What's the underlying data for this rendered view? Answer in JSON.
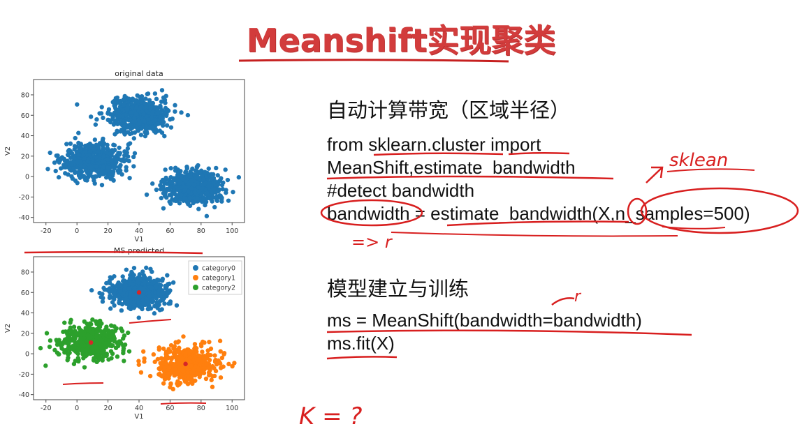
{
  "title": "Meanshift实现聚类",
  "section1": {
    "heading": "自动计算带宽（区域半径）",
    "code_lines": [
      "from sklearn.cluster import",
      "MeanShift,estimate_bandwidth",
      "#detect bandwidth",
      "bandwidth = estimate_bandwidth(X,n_samples=500)"
    ]
  },
  "section2": {
    "heading": "模型建立与训练",
    "code_lines": [
      "ms = MeanShift(bandwidth=bandwidth)",
      "ms.fit(X)"
    ]
  },
  "annotations": {
    "sklean": "sklean",
    "arrow_r": "=> r",
    "r_mark": "r",
    "k_question": "K = ?"
  },
  "chart_data": [
    {
      "type": "scatter",
      "title": "original data",
      "xlabel": "V1",
      "ylabel": "V2",
      "xlim": [
        -28,
        108
      ],
      "ylim": [
        -45,
        95
      ],
      "xticks": [
        -20,
        0,
        20,
        40,
        60,
        80,
        100
      ],
      "yticks": [
        -40,
        -20,
        0,
        20,
        40,
        60,
        80
      ],
      "series": [
        {
          "color": "#1f77b4",
          "clusters": [
            {
              "center": [
                40,
                60
              ],
              "points": 500
            },
            {
              "center": [
                10,
                15
              ],
              "points": 500
            },
            {
              "center": [
                75,
                -10
              ],
              "points": 500
            }
          ]
        }
      ]
    },
    {
      "type": "scatter",
      "title": "MS predicted",
      "xlabel": "V1",
      "ylabel": "V2",
      "xlim": [
        -28,
        108
      ],
      "ylim": [
        -45,
        95
      ],
      "xticks": [
        -20,
        0,
        20,
        40,
        60,
        80,
        100
      ],
      "yticks": [
        -40,
        -20,
        0,
        20,
        40,
        60,
        80
      ],
      "legend_position": "top-right",
      "series": [
        {
          "name": "category0",
          "color": "#1f77b4",
          "center": [
            40,
            60
          ],
          "points": 500
        },
        {
          "name": "category1",
          "color": "#ff7f0e",
          "center": [
            70,
            -10
          ],
          "points": 500
        },
        {
          "name": "category2",
          "color": "#2ca02c",
          "center": [
            9,
            11
          ],
          "points": 500
        }
      ],
      "cluster_centers": [
        [
          40,
          60
        ],
        [
          70,
          -10
        ],
        [
          9,
          11
        ]
      ],
      "center_color": "#d62728"
    }
  ]
}
